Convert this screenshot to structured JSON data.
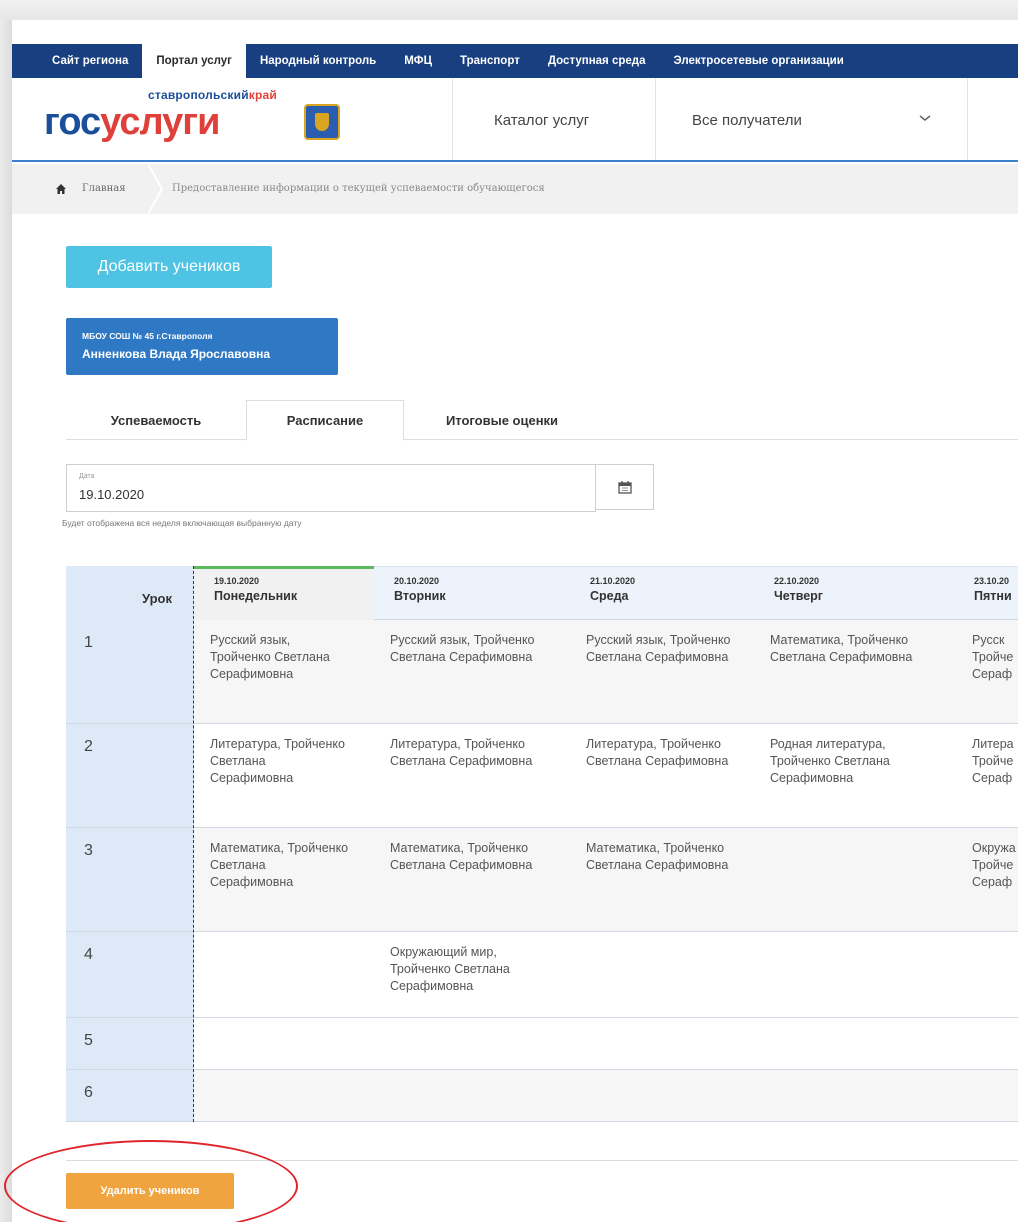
{
  "topnav": {
    "items": [
      "Сайт региона",
      "Портал услуг",
      "Народный контроль",
      "МФЦ",
      "Транспорт",
      "Доступная среда",
      "Электросетевые организации"
    ],
    "active_index": 1
  },
  "header": {
    "logo_region": "ставропольский",
    "logo_kraj": "край",
    "logo_gos": "гос",
    "logo_uslugi": "услуги",
    "catalog": "Каталог услуг",
    "recipients": "Все получатели"
  },
  "breadcrumb": {
    "home": "Главная",
    "current": "Предоставление информации о текущей успеваемости обучающегося"
  },
  "add_students_button": "Добавить учеников",
  "student": {
    "school": "МБОУ СОШ № 45 г.Ставрополя",
    "name": "Анненкова Влада Ярославовна"
  },
  "tabs": [
    "Успеваемость",
    "Расписание",
    "Итоговые оценки"
  ],
  "active_tab": 1,
  "date": {
    "label": "Дата",
    "value": "19.10.2020",
    "hint": "Будет отображена вся неделя включающая выбранную дату"
  },
  "schedule": {
    "lesson_header": "Урок",
    "days": [
      {
        "date": "19.10.2020",
        "name": "Понедельник"
      },
      {
        "date": "20.10.2020",
        "name": "Вторник"
      },
      {
        "date": "21.10.2020",
        "name": "Среда"
      },
      {
        "date": "22.10.2020",
        "name": "Четверг"
      },
      {
        "date": "23.10.20",
        "name": "Пятни"
      }
    ],
    "rows": [
      {
        "num": "1",
        "mon": "Русский язык, Тройченко Светлана Серафимовна",
        "tue": "Русский язык, Тройченко Светлана Серафимовна",
        "wed": "Русский язык, Тройченко Светлана Серафимовна",
        "thu": "Математика, Тройченко Светлана Серафимовна",
        "fri": "Русск\nТройче\nСераф"
      },
      {
        "num": "2",
        "mon": "Литература, Тройченко Светлана Серафимовна",
        "tue": "Литература, Тройченко Светлана Серафимовна",
        "wed": "Литература, Тройченко Светлана Серафимовна",
        "thu": "Родная литература, Тройченко Светлана Серафимовна",
        "fri": "Литера\nТройче\nСераф"
      },
      {
        "num": "3",
        "mon": "Математика, Тройченко Светлана Серафимовна",
        "tue": "Математика, Тройченко Светлана Серафимовна",
        "wed": "Математика, Тройченко Светлана Серафимовна",
        "thu": "",
        "fri": "Окружа\nТройче\nСераф"
      },
      {
        "num": "4",
        "mon": "",
        "tue": "Окружающий мир, Тройченко Светлана Серафимовна",
        "wed": "",
        "thu": "",
        "fri": ""
      },
      {
        "num": "5",
        "mon": "",
        "tue": "",
        "wed": "",
        "thu": "",
        "fri": ""
      },
      {
        "num": "6",
        "mon": "",
        "tue": "",
        "wed": "",
        "thu": "",
        "fri": ""
      }
    ]
  },
  "delete_students_button": "Удалить учеников",
  "colors": {
    "nav_bg": "#183f7f",
    "accent_blue": "#2f78c4",
    "add_button": "#4fc3e3",
    "delete_button": "#f0a440",
    "highlight": "#e0242b",
    "active_day": "#5cb85c"
  }
}
